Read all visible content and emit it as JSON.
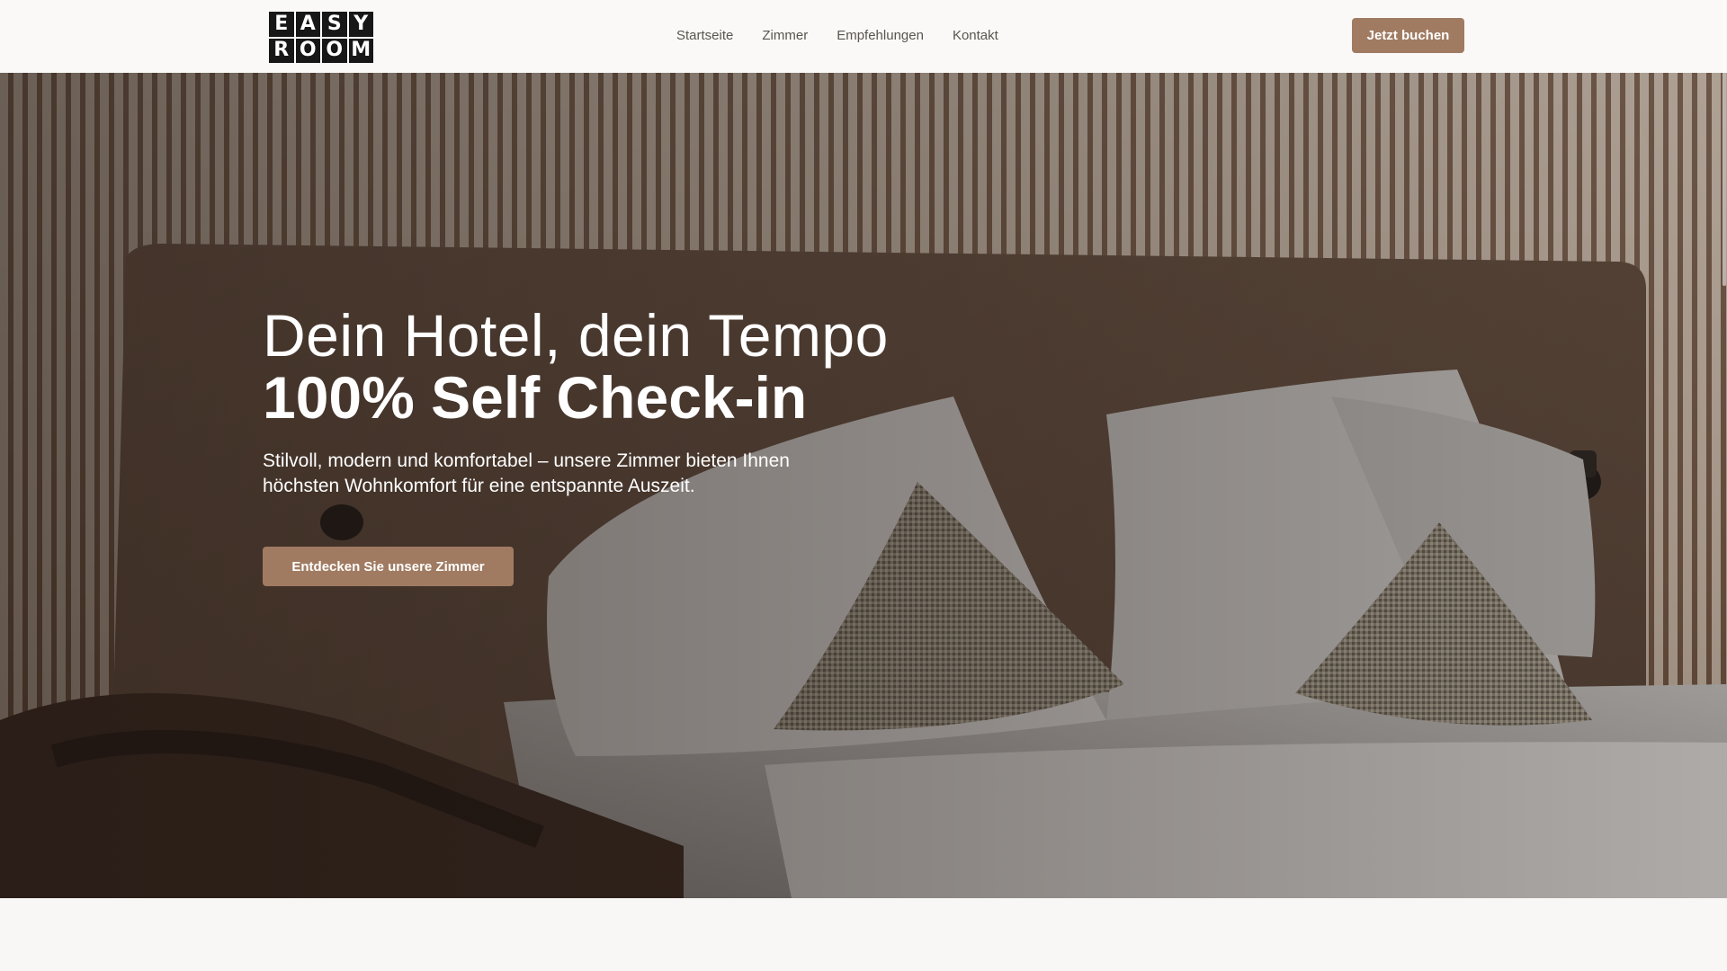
{
  "brand": {
    "logo_letters": [
      "E",
      "A",
      "S",
      "Y",
      "R",
      "O",
      "O",
      "M"
    ]
  },
  "nav": {
    "items": [
      {
        "label": "Startseite"
      },
      {
        "label": "Zimmer"
      },
      {
        "label": "Empfehlungen"
      },
      {
        "label": "Kontakt"
      }
    ],
    "cta_label": "Jetzt buchen"
  },
  "hero": {
    "title_line1": "Dein Hotel, dein Tempo",
    "title_line2": "100% Self Check-in",
    "description": "Stilvoll, modern und komfortabel – unsere Zimmer bieten Ihnen höchsten Wohnkomfort für eine entspannte Auszeit.",
    "button_label": "Entdecken Sie unsere Zimmer"
  },
  "colors": {
    "accent": "#a07b62",
    "header_bg": "#faf9f7",
    "page_bg": "#f8f7f5",
    "nav_text": "#5a5550",
    "logo_tile": "#171717"
  }
}
